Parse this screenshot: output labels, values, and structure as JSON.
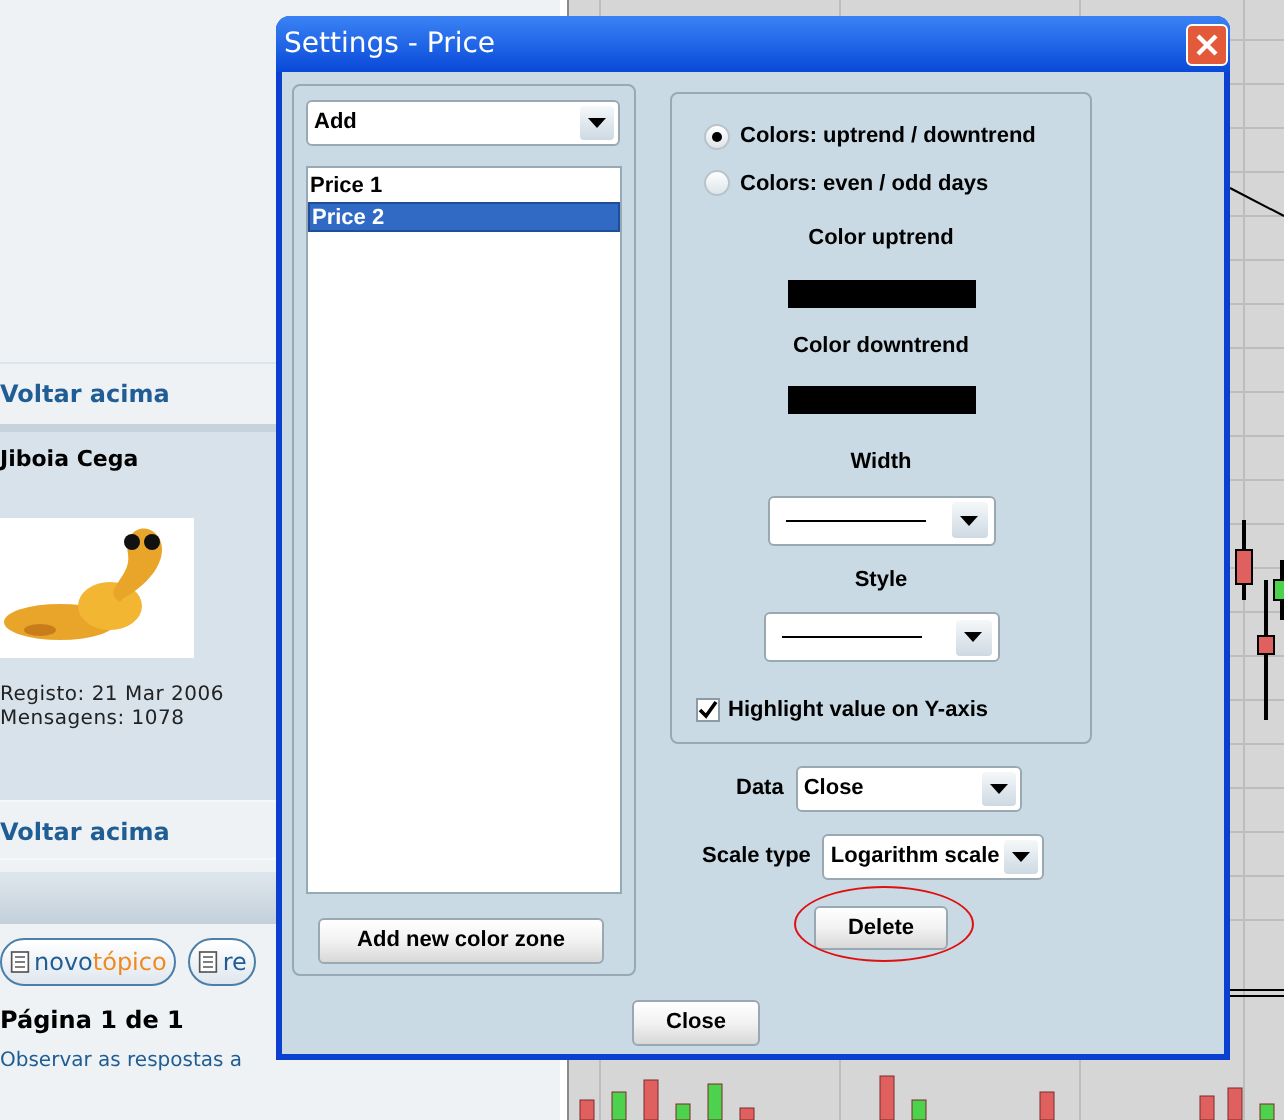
{
  "forum": {
    "top_link": "Voltar acima",
    "username": "Jiboia Cega",
    "registered": "Registo: 21 Mar 2006",
    "posts": "Mensagens: 1078",
    "bottom_link": "Voltar acima",
    "buttons": [
      {
        "parts": [
          "novo",
          "tópico"
        ]
      },
      {
        "parts": [
          "re"
        ]
      }
    ],
    "pagination": "Página 1 de 1",
    "watch_link": "Observar as respostas a"
  },
  "dialog": {
    "title": "Settings - Price",
    "add_select": {
      "value": "Add"
    },
    "zones": [
      {
        "label": "Price 1",
        "selected": false
      },
      {
        "label": "Price 2",
        "selected": true
      }
    ],
    "add_button": "Add new color zone",
    "color_modes": [
      {
        "label": "Colors: uptrend / downtrend",
        "selected": true
      },
      {
        "label": "Colors: even / odd days",
        "selected": false
      }
    ],
    "swatches": [
      {
        "label": "Color uptrend",
        "color": "#000000"
      },
      {
        "label": "Color downtrend",
        "color": "#000000"
      }
    ],
    "line_selects": [
      {
        "label": "Width"
      },
      {
        "label": "Style"
      }
    ],
    "highlight": {
      "label": "Highlight value on Y-axis",
      "checked": true
    },
    "fields": [
      {
        "label": "Data",
        "value": "Close"
      },
      {
        "label": "Scale type",
        "value": "Logarithm scale"
      }
    ],
    "delete_button": {
      "label": "Delete",
      "circled": true
    },
    "close_button": "Close"
  }
}
